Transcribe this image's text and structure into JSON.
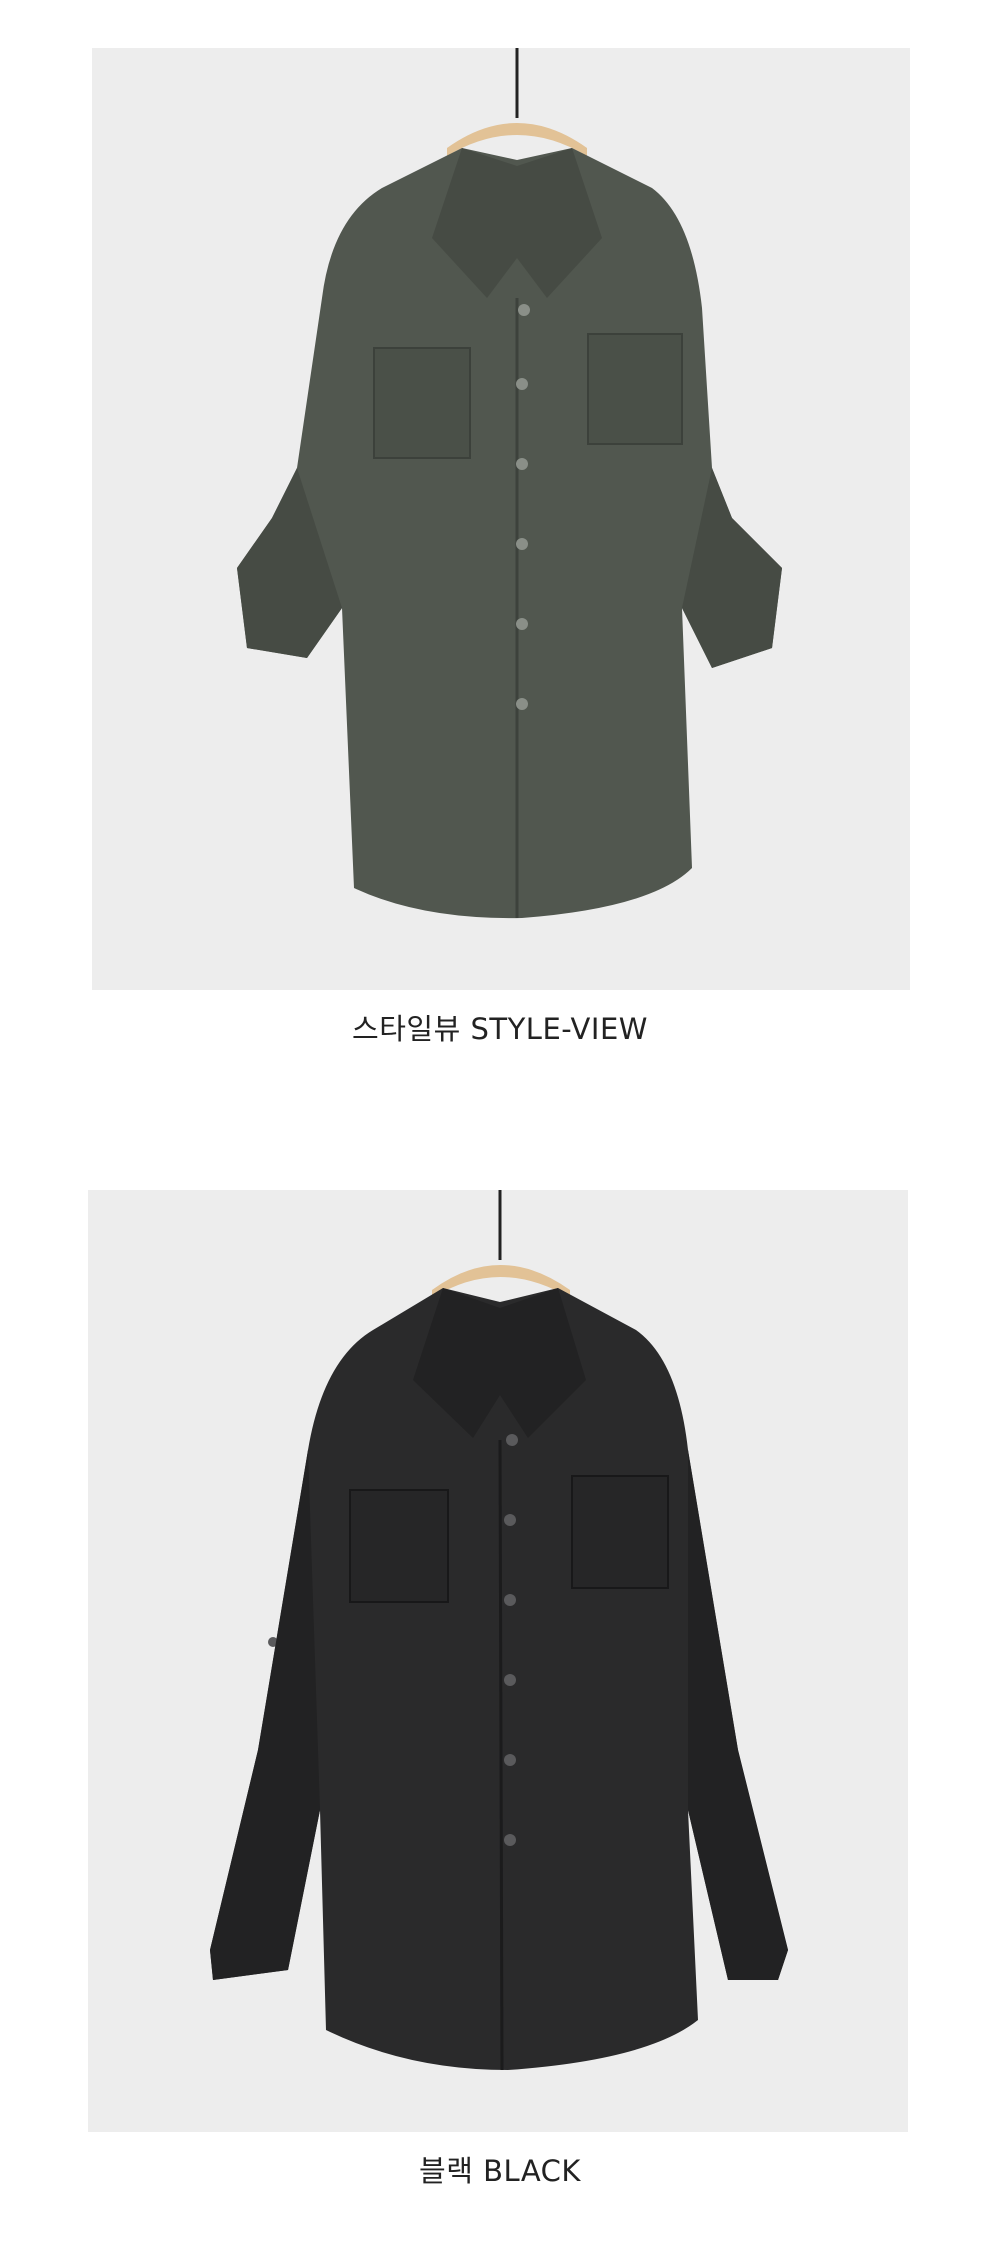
{
  "sections": [
    {
      "caption": "스타일뷰 STYLE-VIEW",
      "image": {
        "subject": "shirt-photo",
        "shirt_color": "#4f554e",
        "shirt_dark": "#3c413b",
        "background": "#ececec",
        "hanger_color": "#e3c49a"
      }
    },
    {
      "caption": "블랙 BLACK",
      "image": {
        "subject": "shirt-photo",
        "shirt_color": "#2a2a2b",
        "shirt_dark": "#1b1b1c",
        "background": "#ececec",
        "hanger_color": "#e3c49a"
      }
    }
  ]
}
